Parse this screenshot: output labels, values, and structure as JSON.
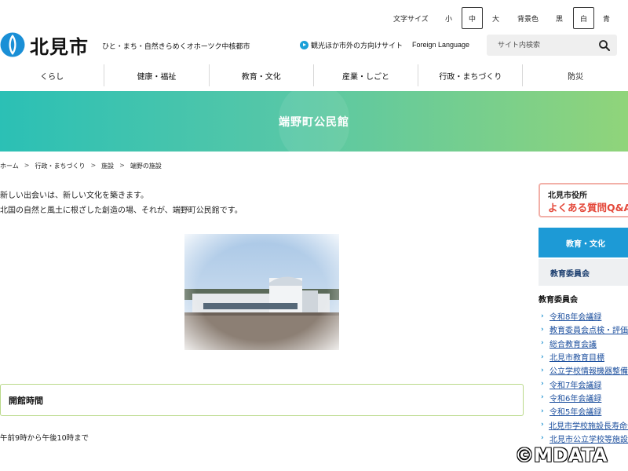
{
  "utility": {
    "text_size_label": "文字サイズ",
    "text_sizes": [
      "小",
      "中",
      "大"
    ],
    "text_size_selected": "中",
    "bg_color_label": "背景色",
    "bg_colors": [
      "黒",
      "白",
      "青"
    ],
    "bg_color_selected": "白"
  },
  "header": {
    "site_name": "北見市",
    "tagline": "ひと・まち・自然きらめくオホーツク中核都市",
    "tourist_link": "観光ほか市外の方向けサイト",
    "foreign_link": "Foreign Language",
    "search_placeholder": "サイト内検索",
    "logo_color": "#1a8fd6"
  },
  "nav": {
    "items": [
      "くらし",
      "健康・福祉",
      "教育・文化",
      "産業・しごと",
      "行政・まちづくり",
      "防災"
    ]
  },
  "banner": {
    "title": "端野町公民館"
  },
  "breadcrumb": [
    "ホーム",
    "行政・まちづくり",
    "施設",
    "端野の施設"
  ],
  "main": {
    "intro_line1": "新しい出会いは、新しい文化を築きます。",
    "intro_line2": "北国の自然と風土に根ざした創造の場、それが、端野町公民館です。",
    "section1_title": "開館時間",
    "hours": "午前9時から午後10時まで"
  },
  "sidebar": {
    "faq_line1": "北見市役所",
    "faq_line2": "よくある質問Q&A",
    "category_head": "教育・文化",
    "category_sub": "教育委員会",
    "list_title": "教育委員会",
    "links": [
      "令和8年会議録",
      "教育委員会点検・評価",
      "総合教育会議",
      "北見市教育目標",
      "公立学校情報機器整備",
      "令和7年会議録",
      "令和6年会議録",
      "令和5年会議録",
      "北見市学校施設長寿命化",
      "北見市公立学校等施設"
    ]
  },
  "watermark": "©MDATA"
}
